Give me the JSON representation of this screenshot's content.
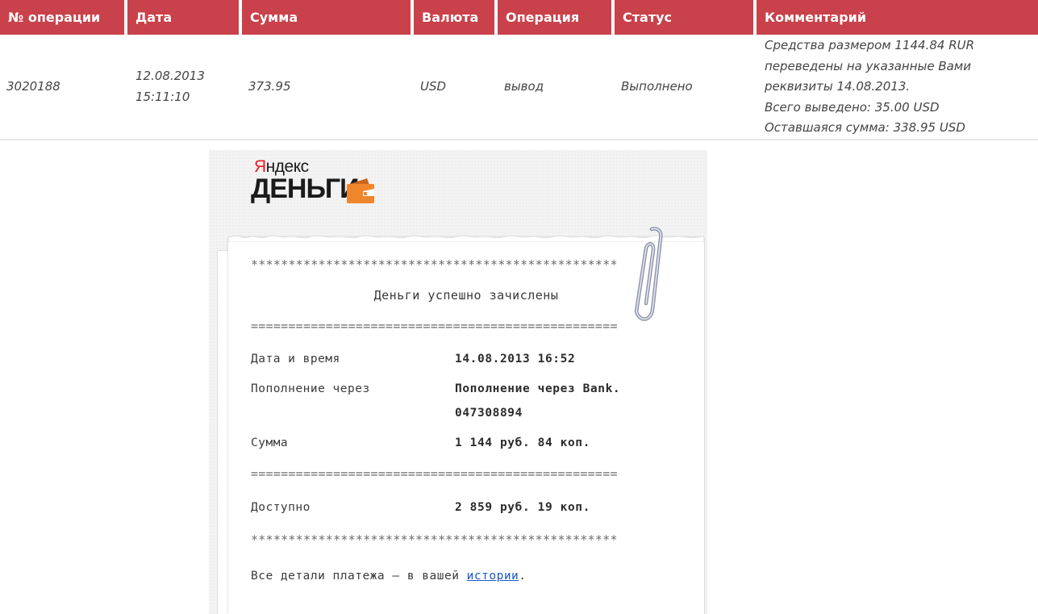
{
  "table": {
    "headers": [
      "№ операции",
      "Дата",
      "Сумма",
      "Валюта",
      "Операция",
      "Статус",
      "Комментарий"
    ],
    "header_color": "#c9414a",
    "row": {
      "id": "3020188",
      "date": "12.08.2013",
      "time": "15:11:10",
      "amount": "373.95",
      "currency": "USD",
      "operation": "вывод",
      "status": "Выполнено",
      "comment_lines": [
        "Средства размером 1144.84 RUR",
        "переведены на указанные Вами",
        "реквизиты 14.08.2013.",
        "Всего выведено: 35.00 USD",
        "Оставшаяся сумма: 338.95 USD"
      ]
    }
  },
  "receipt": {
    "logo_top": "Яндекс",
    "logo_main": "ДЕНЬГИ",
    "brand_color": "#e31e24",
    "wallet_color": "#f0862c",
    "stars": "*************************************************",
    "headline": "Деньги успешно зачислены",
    "equals": "=================================================",
    "rows": [
      {
        "label": "Дата и время",
        "value": "14.08.2013 16:52"
      },
      {
        "label": "Пополнение через",
        "value": "Пополнение через Bank.",
        "value2": "047308894"
      },
      {
        "label": "Сумма",
        "value": "1 144 руб. 84 коп."
      },
      {
        "label": "Доступно",
        "value": "2 859 руб. 19 коп."
      }
    ],
    "footer_prefix": "Все детали платежа — в вашей ",
    "footer_link": "истории",
    "footer_suffix": "."
  }
}
